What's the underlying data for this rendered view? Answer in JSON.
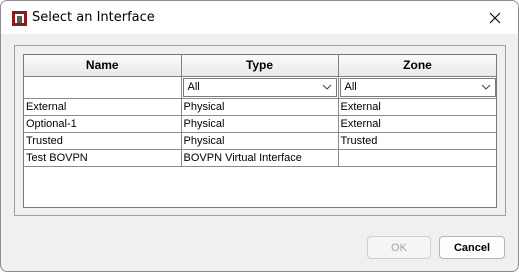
{
  "window": {
    "title": "Select an Interface",
    "close_icon": "close-icon",
    "app_icon": "watchguard-app-icon"
  },
  "table": {
    "columns": [
      {
        "label": "Name"
      },
      {
        "label": "Type"
      },
      {
        "label": "Zone"
      }
    ],
    "filters": {
      "type": "All",
      "zone": "All"
    },
    "rows": [
      {
        "name": "External",
        "type": "Physical",
        "zone": "External"
      },
      {
        "name": "Optional-1",
        "type": "Physical",
        "zone": "External"
      },
      {
        "name": "Trusted",
        "type": "Physical",
        "zone": "Trusted"
      },
      {
        "name": "Test BOVPN",
        "type": "BOVPN Virtual Interface",
        "zone": ""
      }
    ]
  },
  "buttons": {
    "ok_label": "OK",
    "cancel_label": "Cancel"
  }
}
